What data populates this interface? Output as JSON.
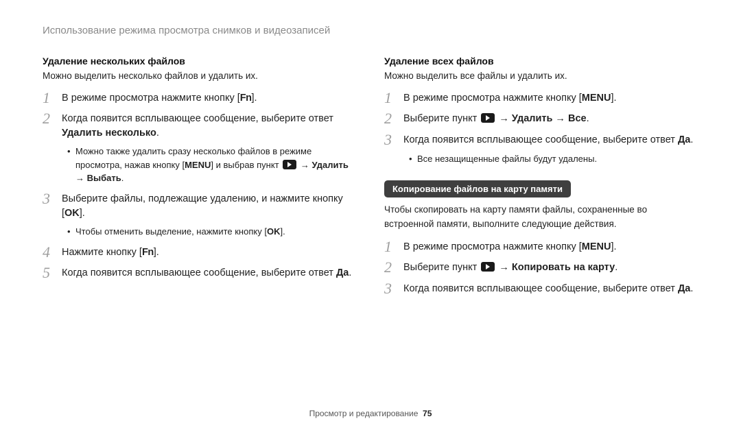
{
  "header": "Использование режима просмотра снимков и видеозаписей",
  "left": {
    "heading": "Удаление нескольких файлов",
    "intro": "Можно выделить несколько файлов и удалить их.",
    "step1_a": "В режиме просмотра нажмите кнопку [",
    "step1_key": "Fn",
    "step1_b": "].",
    "step2_a": "Когда появится всплывающее сообщение, выберите ответ ",
    "step2_bold": "Удалить несколько",
    "step2_b": ".",
    "b1_a": "Можно также удалить сразу несколько файлов в режиме просмотра, нажав кнопку [",
    "b1_key": "MENU",
    "b1_b": "] и выбрав пункт ",
    "b1_c": " → ",
    "b1_bold1": "Удалить",
    "b1_d": " → ",
    "b1_bold2": "Выбать",
    "b1_e": ".",
    "step3_a": "Выберите файлы, подлежащие удалению, и нажмите кнопку [",
    "step3_key": "OK",
    "step3_b": "].",
    "b2_a": "Чтобы отменить выделение, нажмите кнопку [",
    "b2_key": "OK",
    "b2_b": "].",
    "step4_a": "Нажмите кнопку [",
    "step4_key": "Fn",
    "step4_b": "].",
    "step5_a": "Когда появится всплывающее сообщение, выберите ответ ",
    "step5_bold": "Да",
    "step5_b": "."
  },
  "right": {
    "heading": "Удаление всех файлов",
    "intro": "Можно выделить все файлы и удалить их.",
    "r1_a": "В режиме просмотра нажмите кнопку [",
    "r1_key": "MENU",
    "r1_b": "].",
    "r2_a": "Выберите пункт ",
    "r2_b": " → ",
    "r2_bold1": "Удалить",
    "r2_c": " → ",
    "r2_bold2": "Все",
    "r2_d": ".",
    "r3_a": "Когда появится всплывающее сообщение, выберите ответ ",
    "r3_bold": "Да",
    "r3_b": ".",
    "rb1": "Все незащищенные файлы будут удалены.",
    "pill": "Копирование файлов на карту памяти",
    "desc": "Чтобы скопировать на карту памяти файлы, сохраненные во встроенной памяти, выполните следующие действия.",
    "c1_a": "В режиме просмотра нажмите кнопку [",
    "c1_key": "MENU",
    "c1_b": "].",
    "c2_a": "Выберите пункт ",
    "c2_b": " → ",
    "c2_bold": "Копировать на карту",
    "c2_c": ".",
    "c3_a": "Когда появится всплывающее сообщение, выберите ответ ",
    "c3_bold": "Да",
    "c3_b": "."
  },
  "footer": {
    "label": "Просмотр и редактирование",
    "page": "75"
  }
}
